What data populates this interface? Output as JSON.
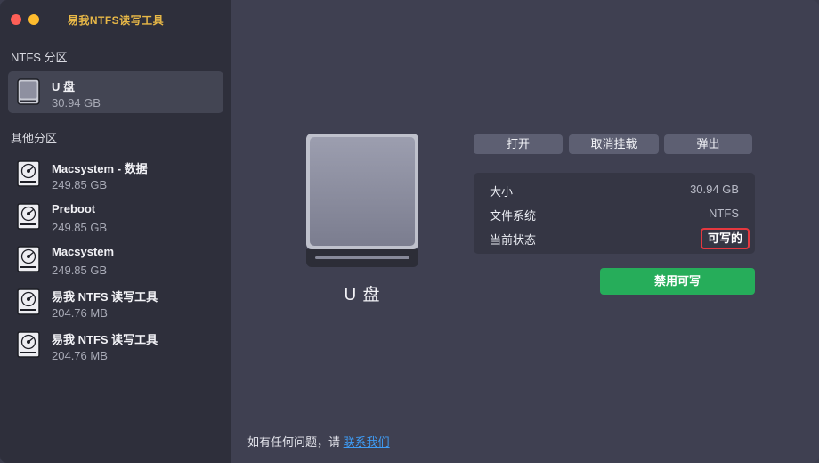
{
  "window": {
    "title": "易我NTFS读写工具"
  },
  "sidebar": {
    "ntfs_section": "NTFS 分区",
    "other_section": "其他分区",
    "ntfs_items": [
      {
        "name": "U 盘",
        "size": "30.94 GB",
        "icon": "usb-drive-icon",
        "selected": true
      }
    ],
    "other_items": [
      {
        "name": "Macsystem - 数据",
        "size": "249.85 GB",
        "icon": "hard-disk-icon"
      },
      {
        "name": "Preboot",
        "size": "249.85 GB",
        "icon": "hard-disk-icon"
      },
      {
        "name": "Macsystem",
        "size": "249.85 GB",
        "icon": "hard-disk-icon"
      },
      {
        "name": "易我 NTFS 读写工具",
        "size": "204.76 MB",
        "icon": "hard-disk-icon"
      },
      {
        "name": "易我 NTFS 读写工具",
        "size": "204.76 MB",
        "icon": "hard-disk-icon"
      }
    ]
  },
  "help": {
    "text": "如有任何问题，请 ",
    "link": "联系我们"
  },
  "main": {
    "disk_name": "U 盘",
    "buttons": {
      "open": "打开",
      "unmount": "取消挂载",
      "eject": "弹出"
    },
    "info": {
      "size_label": "大小",
      "size_value": "30.94 GB",
      "fs_label": "文件系统",
      "fs_value": "NTFS",
      "status_label": "当前状态",
      "status_value": "可写的"
    },
    "disable_write_button": "禁用可写"
  },
  "colors": {
    "accent_green": "#26ad5a",
    "status_border": "#e5383f",
    "link": "#3f9cf5",
    "title": "#e8b847"
  }
}
